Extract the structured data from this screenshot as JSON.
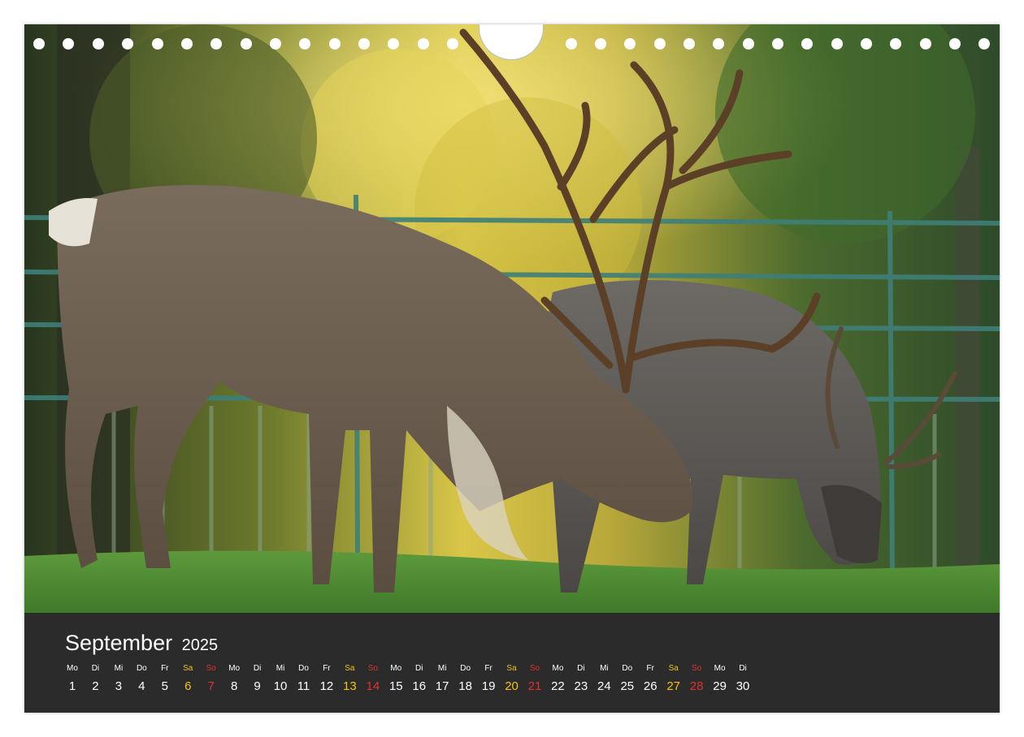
{
  "calendar": {
    "month": "September",
    "year": "2025",
    "days": [
      {
        "wd": "Mo",
        "d": "1"
      },
      {
        "wd": "Di",
        "d": "2"
      },
      {
        "wd": "Mi",
        "d": "3"
      },
      {
        "wd": "Do",
        "d": "4"
      },
      {
        "wd": "Fr",
        "d": "5"
      },
      {
        "wd": "Sa",
        "d": "6"
      },
      {
        "wd": "So",
        "d": "7"
      },
      {
        "wd": "Mo",
        "d": "8"
      },
      {
        "wd": "Di",
        "d": "9"
      },
      {
        "wd": "Mi",
        "d": "10"
      },
      {
        "wd": "Do",
        "d": "11"
      },
      {
        "wd": "Fr",
        "d": "12"
      },
      {
        "wd": "Sa",
        "d": "13"
      },
      {
        "wd": "So",
        "d": "14"
      },
      {
        "wd": "Mo",
        "d": "15"
      },
      {
        "wd": "Di",
        "d": "16"
      },
      {
        "wd": "Mi",
        "d": "17"
      },
      {
        "wd": "Do",
        "d": "18"
      },
      {
        "wd": "Fr",
        "d": "19"
      },
      {
        "wd": "Sa",
        "d": "20"
      },
      {
        "wd": "So",
        "d": "21"
      },
      {
        "wd": "Mo",
        "d": "22"
      },
      {
        "wd": "Di",
        "d": "23"
      },
      {
        "wd": "Mi",
        "d": "24"
      },
      {
        "wd": "Do",
        "d": "25"
      },
      {
        "wd": "Fr",
        "d": "26"
      },
      {
        "wd": "Sa",
        "d": "27"
      },
      {
        "wd": "So",
        "d": "28"
      },
      {
        "wd": "Mo",
        "d": "29"
      },
      {
        "wd": "Di",
        "d": "30"
      }
    ]
  },
  "colors": {
    "panel": "#2b2b2b",
    "text": "#ffffff",
    "saturday": "#f2c21b",
    "sunday": "#e0322b"
  },
  "photo": {
    "subject": "two reindeer grazing",
    "icon": "reindeer-photo"
  }
}
